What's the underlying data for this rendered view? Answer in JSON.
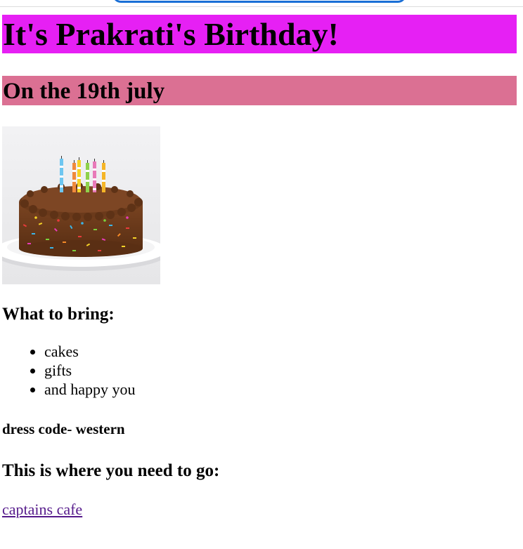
{
  "header": {
    "title": "It's Prakrati's Birthday!",
    "subtitle": "On the 19th july",
    "title_bg": "#e620f4",
    "subtitle_bg": "#db7093"
  },
  "image": {
    "icon": "birthday-cake-image"
  },
  "bring": {
    "heading": "What to bring:",
    "items": [
      "cakes",
      "gifts",
      "and happy you"
    ]
  },
  "dress_code": "dress code- western",
  "location": {
    "heading": "This is where you need to go:",
    "link_text": "captains cafe",
    "link_color": "#551a8b"
  }
}
